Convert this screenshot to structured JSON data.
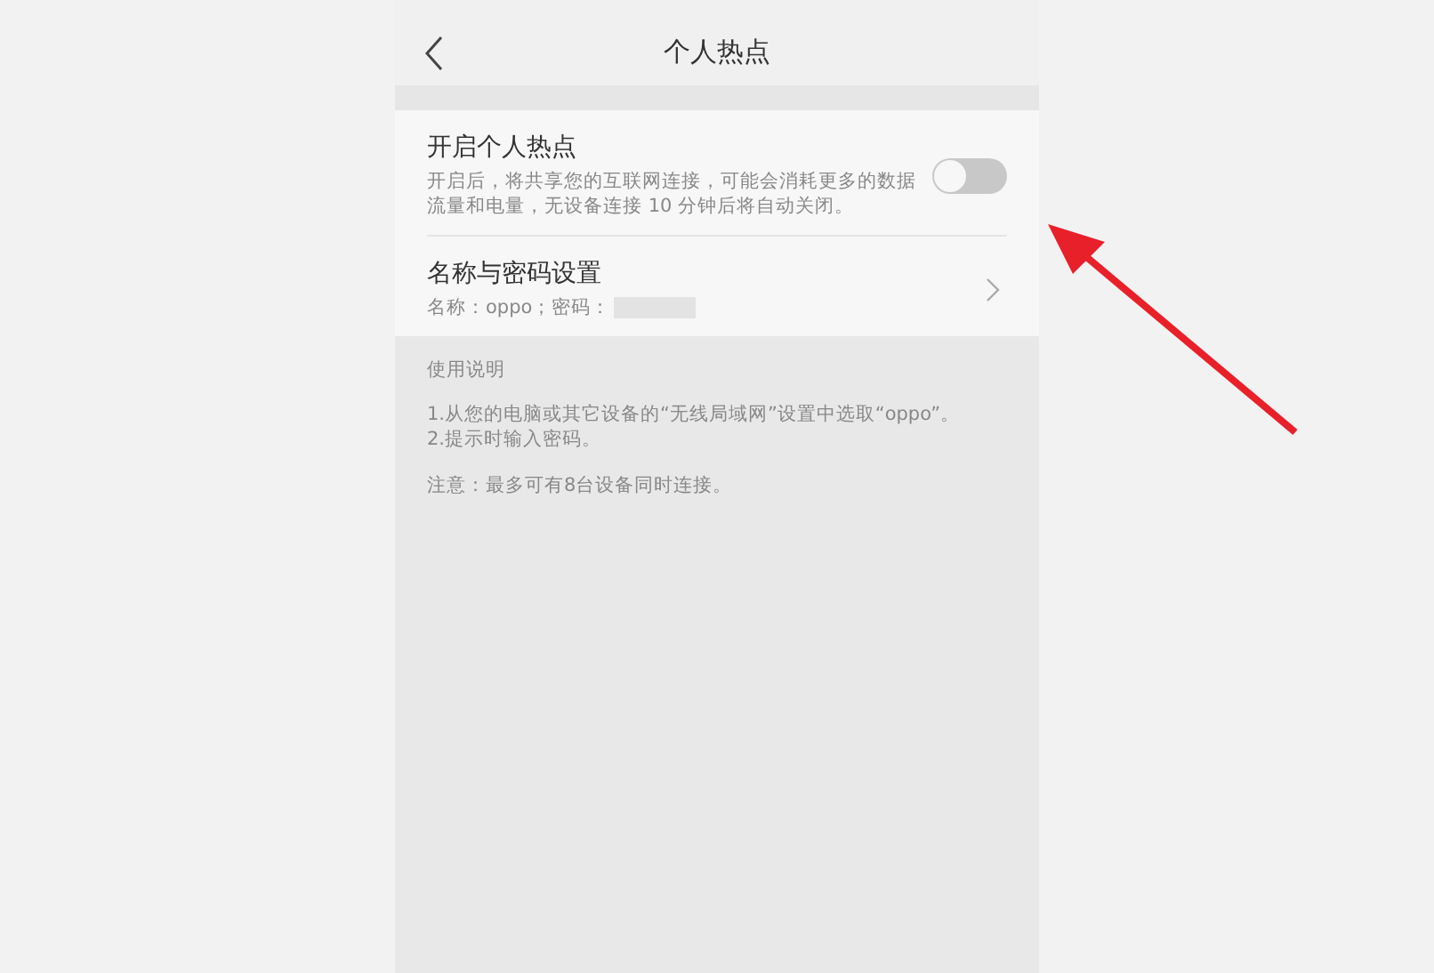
{
  "header": {
    "title": "个人热点"
  },
  "settings": [
    {
      "kind": "toggle",
      "title": "开启个人热点",
      "description": "开启后，将共享您的互联网连接，可能会消耗更多的数据流量和电量，无设备连接 10 分钟后将自动关闭。",
      "on": false
    },
    {
      "kind": "link",
      "title": "名称与密码设置",
      "description": "名称：oppo；密码："
    }
  ],
  "instructions": {
    "heading": "使用说明",
    "lines": [
      "1.从您的电脑或其它设备的“无线局域网”设置中选取“oppo”。",
      "2.提示时输入密码。"
    ],
    "note": "注意：最多可有8台设备同时连接。"
  }
}
